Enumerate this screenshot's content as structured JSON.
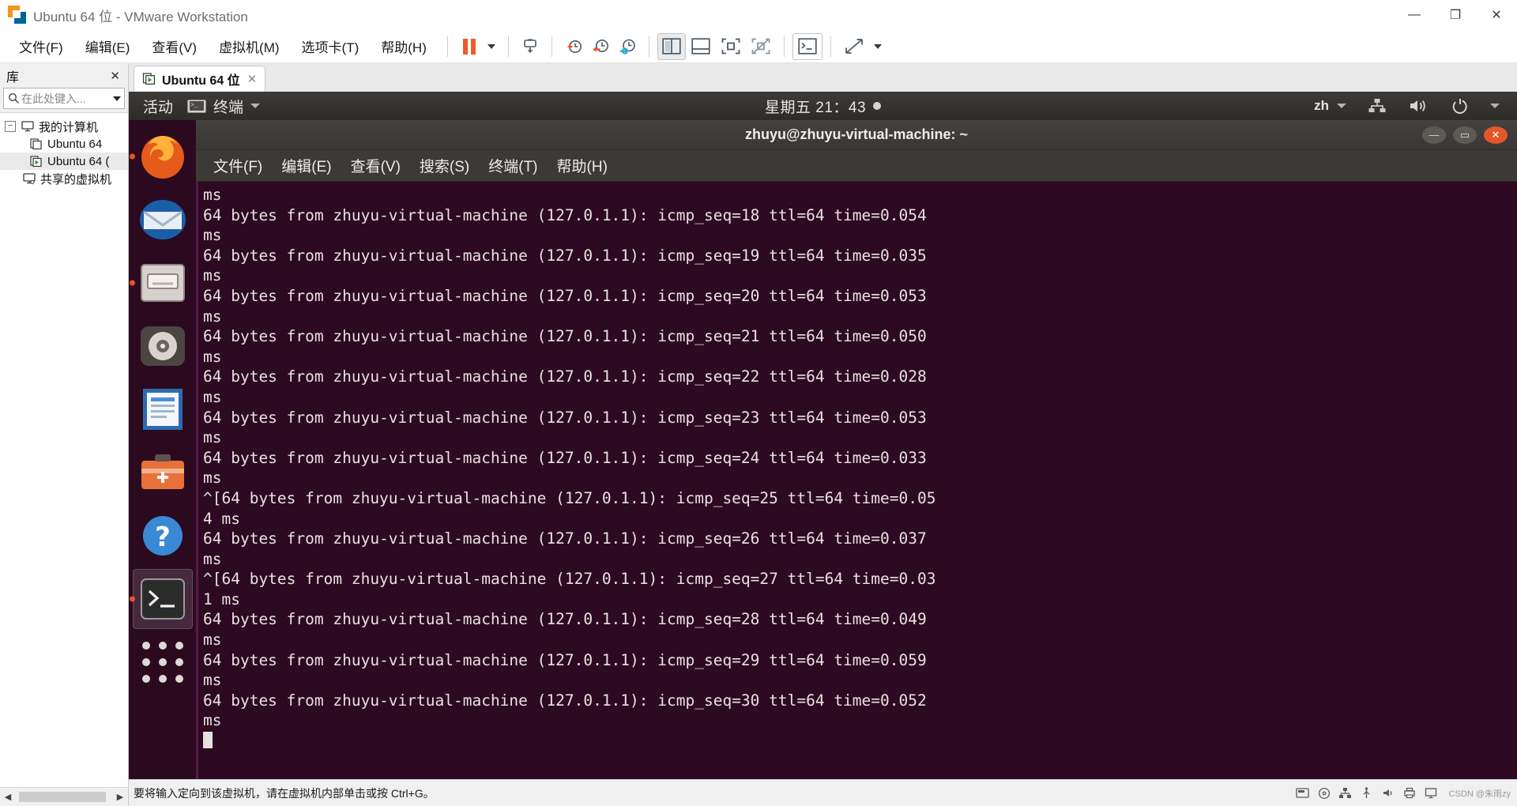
{
  "window": {
    "title": "Ubuntu 64 位 - VMware Workstation",
    "minimize_label": "—",
    "maximize_label": "❐",
    "close_label": "✕"
  },
  "menubar": {
    "items": [
      {
        "label": "文件(F)",
        "name": "menu-file"
      },
      {
        "label": "编辑(E)",
        "name": "menu-edit"
      },
      {
        "label": "查看(V)",
        "name": "menu-view"
      },
      {
        "label": "虚拟机(M)",
        "name": "menu-vm"
      },
      {
        "label": "选项卡(T)",
        "name": "menu-tabs"
      },
      {
        "label": "帮助(H)",
        "name": "menu-help"
      }
    ],
    "toolbar_icons": [
      {
        "name": "suspend-icon",
        "title": "挂起"
      },
      {
        "name": "suspend-dropdown-icon",
        "title": "挂起选项"
      },
      {
        "name": "power-manage-icon",
        "title": "电源"
      },
      {
        "name": "snapshot-take-icon",
        "title": "拍摄快照"
      },
      {
        "name": "snapshot-revert-icon",
        "title": "恢复快照"
      },
      {
        "name": "snapshot-manage-icon",
        "title": "快照管理器"
      },
      {
        "name": "show-library-icon",
        "title": "显示或隐藏库"
      },
      {
        "name": "show-console-view-icon",
        "title": "控制台视图"
      },
      {
        "name": "fullscreen-icon",
        "title": "全屏"
      },
      {
        "name": "unity-icon",
        "title": "Unity 模式"
      },
      {
        "name": "console-icon",
        "title": "控制台"
      },
      {
        "name": "stretch-icon",
        "title": "拉伸"
      },
      {
        "name": "stretch-dropdown-icon",
        "title": "拉伸选项"
      }
    ]
  },
  "library": {
    "title": "库",
    "close_label": "✕",
    "search_placeholder": "在此处键入...",
    "search_value": "",
    "tree": [
      {
        "label": "我的计算机",
        "level": 0,
        "expander": "−",
        "icon": "computer-icon",
        "selected": false
      },
      {
        "label": "Ubuntu 64",
        "level": 2,
        "expander": "",
        "icon": "vm-off-icon",
        "selected": false
      },
      {
        "label": "Ubuntu 64 (",
        "level": 2,
        "expander": "",
        "icon": "vm-running-icon",
        "selected": true
      },
      {
        "label": "共享的虚拟机",
        "level": 0,
        "expander": "",
        "icon": "shared-vm-icon",
        "selected": false
      }
    ],
    "scroll_left": "◀",
    "scroll_right": "▶"
  },
  "tabs": [
    {
      "label": "Ubuntu 64 位",
      "close_label": "✕",
      "active": true
    }
  ],
  "guest": {
    "gnome_bar": {
      "activities": "活动",
      "app_name": "终端",
      "app_icon": "terminal-icon",
      "clock": "星期五 21：43",
      "indicator_dot": true,
      "ime": "zh",
      "icons": [
        "network-icon",
        "volume-icon",
        "power-icon",
        "chevron-down-icon"
      ]
    },
    "dock": [
      {
        "name": "firefox-icon",
        "running": true,
        "active": false
      },
      {
        "name": "thunderbird-icon",
        "running": false,
        "active": false
      },
      {
        "name": "files-icon",
        "running": true,
        "active": false
      },
      {
        "name": "rhythmbox-icon",
        "running": false,
        "active": false
      },
      {
        "name": "libreoffice-writer-icon",
        "running": false,
        "active": false
      },
      {
        "name": "ubuntu-software-icon",
        "running": false,
        "active": false
      },
      {
        "name": "help-icon",
        "running": false,
        "active": false
      },
      {
        "name": "terminal-icon",
        "running": true,
        "active": true
      },
      {
        "name": "show-applications-icon",
        "running": false,
        "active": false
      }
    ],
    "terminal": {
      "title": "zhuyu@zhuyu-virtual-machine: ~",
      "window_buttons": {
        "minimize": "—",
        "maximize": "▭",
        "close": "✕"
      },
      "menu": [
        "文件(F)",
        "编辑(E)",
        "查看(V)",
        "搜索(S)",
        "终端(T)",
        "帮助(H)"
      ],
      "lines": [
        "ms",
        "64 bytes from zhuyu-virtual-machine (127.0.1.1): icmp_seq=18 ttl=64 time=0.054",
        "ms",
        "64 bytes from zhuyu-virtual-machine (127.0.1.1): icmp_seq=19 ttl=64 time=0.035",
        "ms",
        "64 bytes from zhuyu-virtual-machine (127.0.1.1): icmp_seq=20 ttl=64 time=0.053",
        "ms",
        "64 bytes from zhuyu-virtual-machine (127.0.1.1): icmp_seq=21 ttl=64 time=0.050",
        "ms",
        "64 bytes from zhuyu-virtual-machine (127.0.1.1): icmp_seq=22 ttl=64 time=0.028",
        "ms",
        "64 bytes from zhuyu-virtual-machine (127.0.1.1): icmp_seq=23 ttl=64 time=0.053",
        "ms",
        "64 bytes from zhuyu-virtual-machine (127.0.1.1): icmp_seq=24 ttl=64 time=0.033",
        "ms",
        "^[64 bytes from zhuyu-virtual-machine (127.0.1.1): icmp_seq=25 ttl=64 time=0.05",
        "4 ms",
        "64 bytes from zhuyu-virtual-machine (127.0.1.1): icmp_seq=26 ttl=64 time=0.037",
        "ms",
        "^[64 bytes from zhuyu-virtual-machine (127.0.1.1): icmp_seq=27 ttl=64 time=0.03",
        "1 ms",
        "64 bytes from zhuyu-virtual-machine (127.0.1.1): icmp_seq=28 ttl=64 time=0.049",
        "ms",
        "64 bytes from zhuyu-virtual-machine (127.0.1.1): icmp_seq=29 ttl=64 time=0.059",
        "ms",
        "64 bytes from zhuyu-virtual-machine (127.0.1.1): icmp_seq=30 ttl=64 time=0.052",
        "ms"
      ]
    }
  },
  "statusbar": {
    "message": "要将输入定向到该虚拟机，请在虚拟机内部单击或按 Ctrl+G。",
    "watermark": "CSDN @朱雨zy",
    "icons": [
      "harddisk-icon",
      "cd-icon",
      "network-adapter-icon",
      "usb-icon",
      "sound-icon",
      "printer-icon",
      "display-icon"
    ]
  },
  "colors": {
    "vmware_orange": "#f05a28",
    "ubuntu_orange": "#e95420",
    "terminal_bg": "#2d0922",
    "gnome_bar": "#3d3b37",
    "dock_bg": "#2b0a20"
  }
}
